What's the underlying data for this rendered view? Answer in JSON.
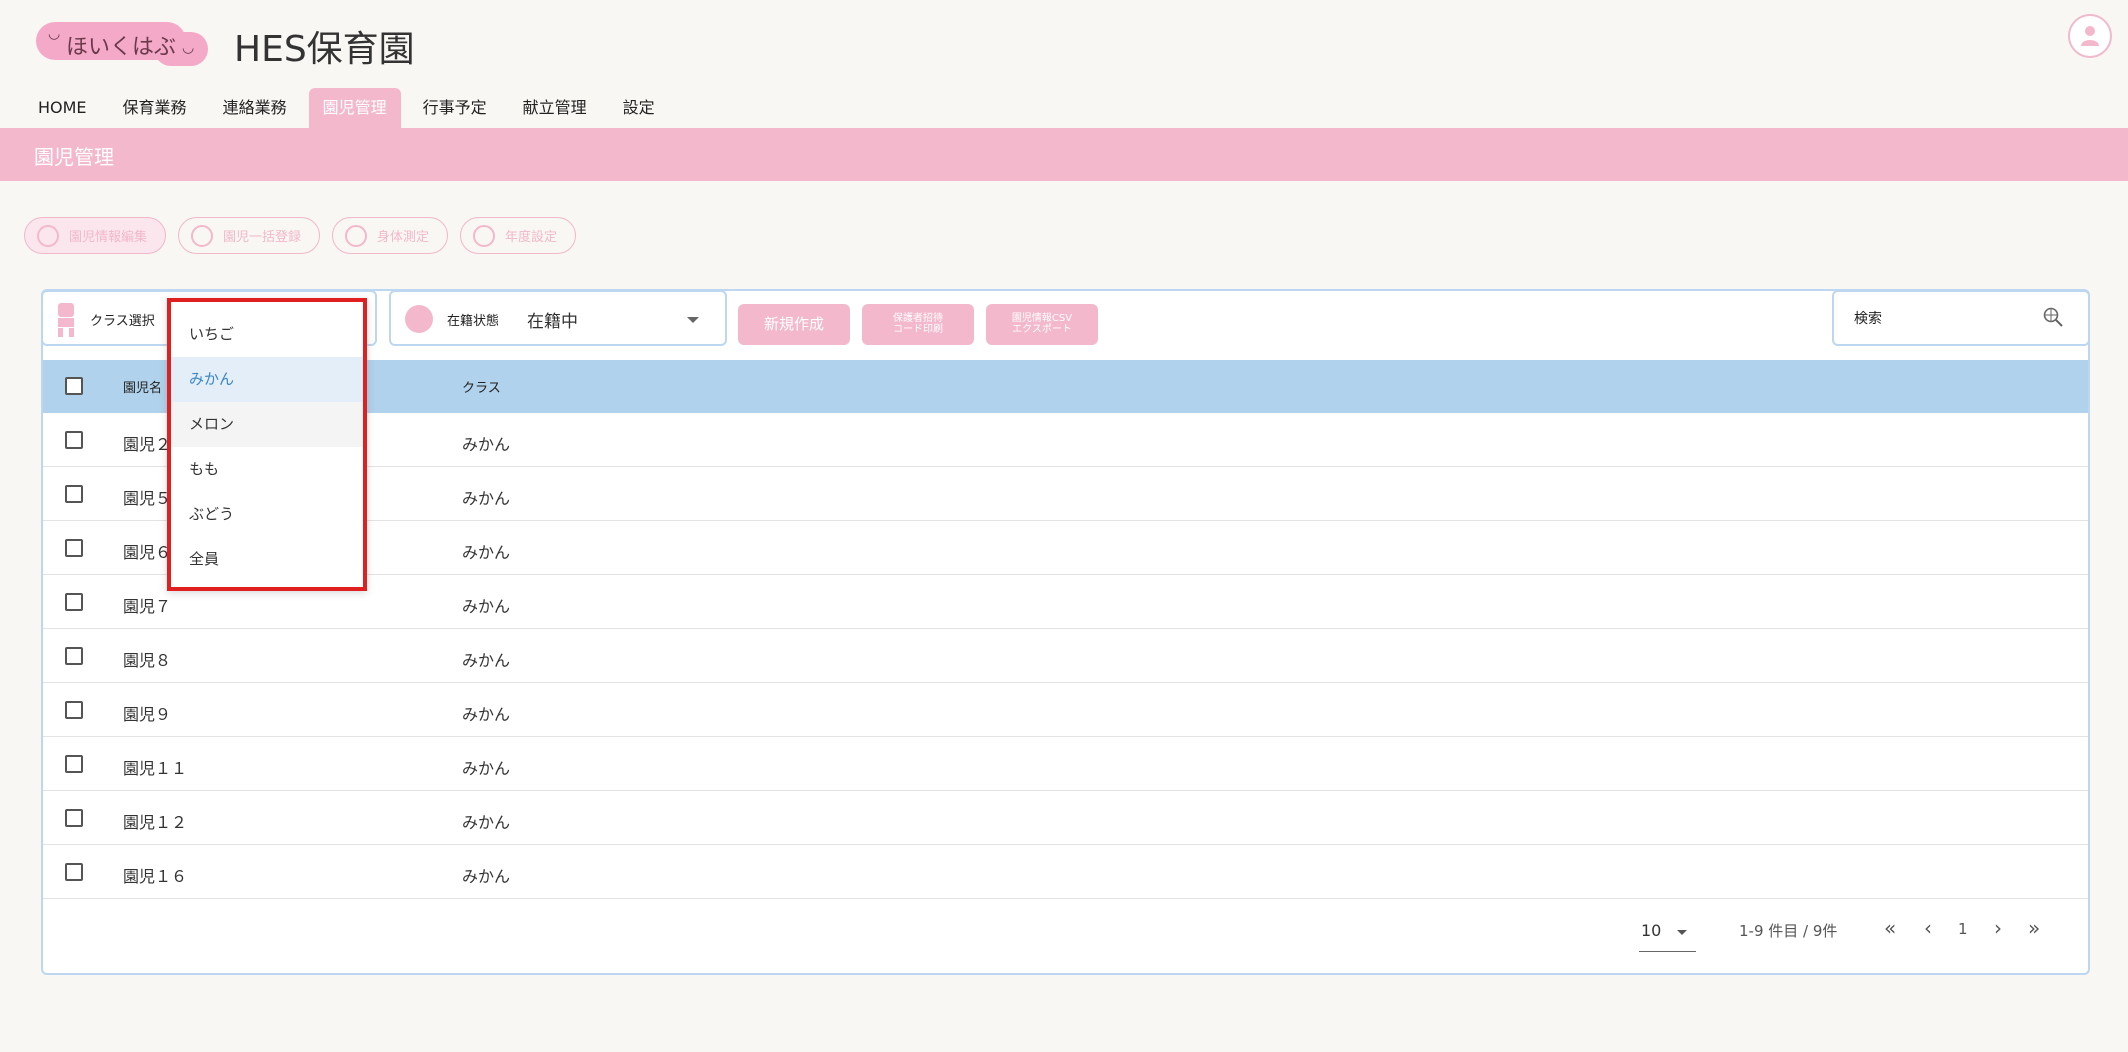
{
  "header": {
    "logo_text": "ほいくはぶ",
    "title": "HES保育園",
    "user_icon": "user-icon"
  },
  "nav": {
    "tabs": [
      "HOME",
      "保育業務",
      "連絡業務",
      "園児管理",
      "行事予定",
      "献立管理",
      "設定"
    ],
    "active": "園児管理"
  },
  "page": {
    "heading": "園児管理"
  },
  "actions": {
    "pills": [
      "園児情報編集",
      "園児一括登録",
      "身体測定",
      "年度設定"
    ]
  },
  "filters": {
    "class_label": "クラス選択",
    "status_label": "在籍状態",
    "status_value": "在籍中",
    "new_button": "新規作成",
    "code_print_line1": "保護者招待",
    "code_print_line2": "コード印刷",
    "csv_line1": "園児情報CSV",
    "csv_line2": "エクスポート",
    "search_placeholder": "検索"
  },
  "dropdown": {
    "options": [
      "いちご",
      "みかん",
      "メロン",
      "もも",
      "ぶどう",
      "全員"
    ],
    "selected": "みかん",
    "hovered": "メロン"
  },
  "table": {
    "columns": [
      "園児名",
      "クラス"
    ],
    "rows": [
      {
        "name": "園児２",
        "class": "みかん"
      },
      {
        "name": "園児５",
        "class": "みかん"
      },
      {
        "name": "園児６",
        "class": "みかん"
      },
      {
        "name": "園児７",
        "class": "みかん"
      },
      {
        "name": "園児８",
        "class": "みかん"
      },
      {
        "name": "園児９",
        "class": "みかん"
      },
      {
        "name": "園児１１",
        "class": "みかん"
      },
      {
        "name": "園児１２",
        "class": "みかん"
      },
      {
        "name": "園児１６",
        "class": "みかん"
      }
    ]
  },
  "pagination": {
    "rows_per_page": "10",
    "range_text": "1-9 件目 / 9件",
    "current_page": "1"
  },
  "colors": {
    "accent_pink": "#f4b8cd",
    "header_blue": "#b1d2ec",
    "highlight_red": "#e02020",
    "selected_blue": "#3a87c6"
  }
}
